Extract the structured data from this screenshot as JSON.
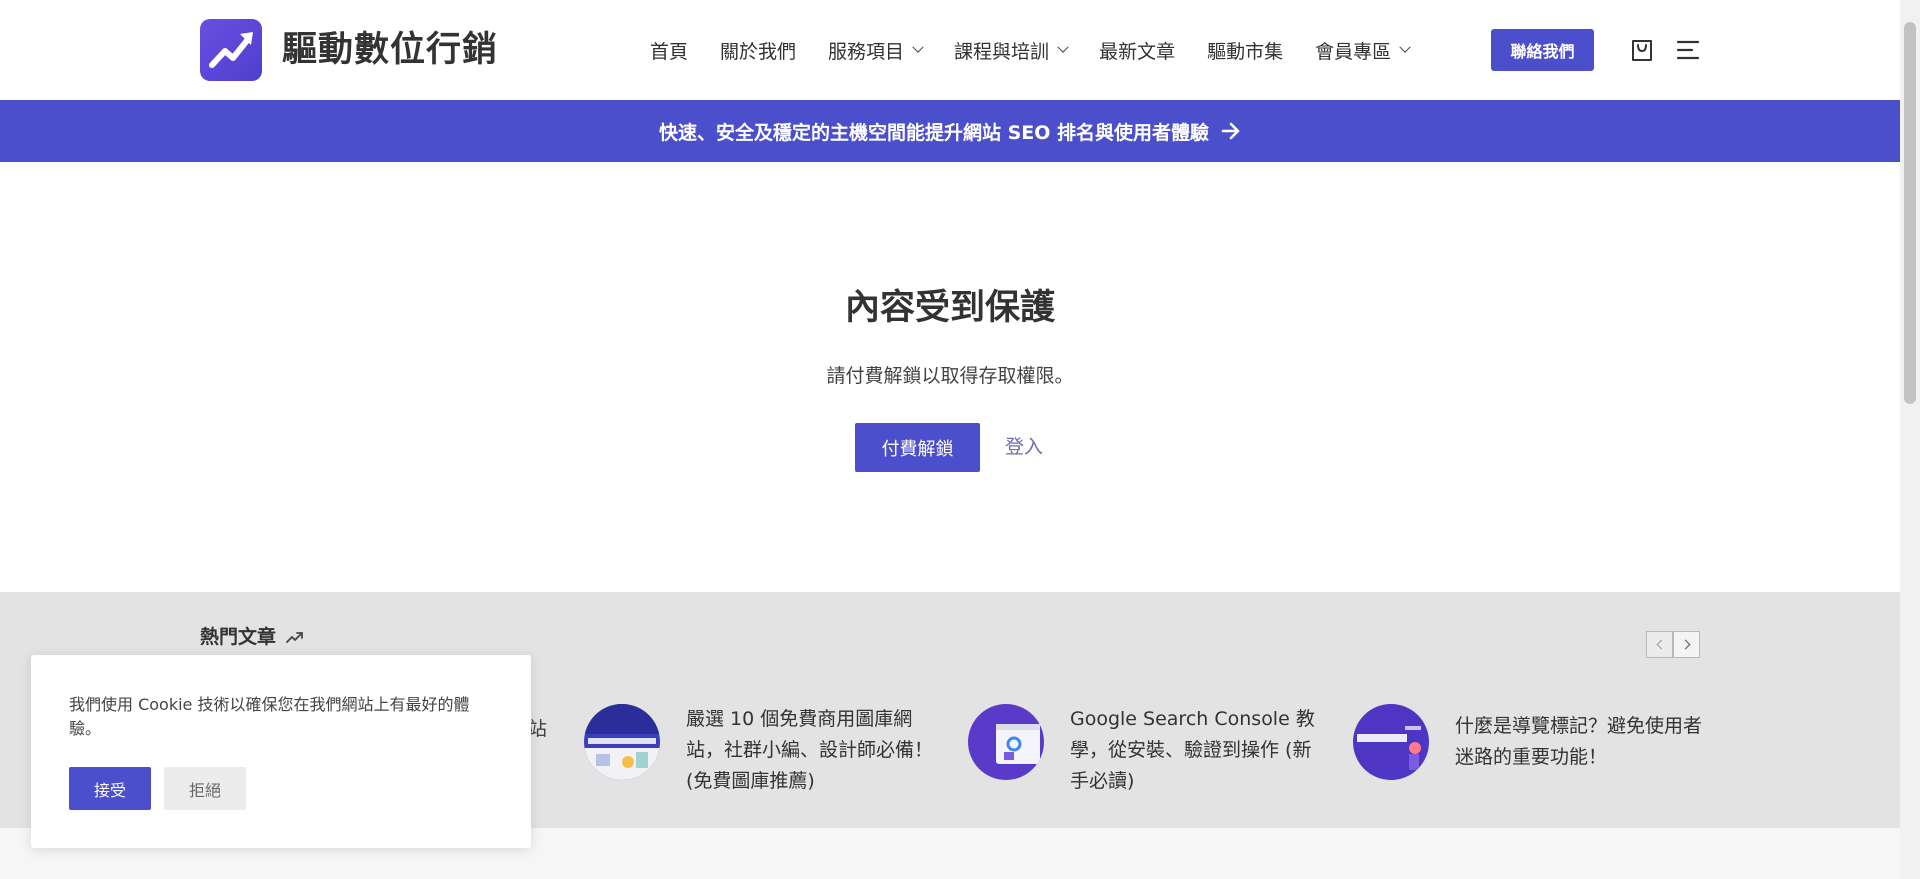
{
  "brand": {
    "name": "驅動數位行銷",
    "accent": "#4b4fcb"
  },
  "nav": {
    "items": [
      {
        "label": "首頁",
        "dropdown": false
      },
      {
        "label": "關於我們",
        "dropdown": false
      },
      {
        "label": "服務項目",
        "dropdown": true
      },
      {
        "label": "課程與培訓",
        "dropdown": true
      },
      {
        "label": "最新文章",
        "dropdown": false
      },
      {
        "label": "驅動市集",
        "dropdown": false
      },
      {
        "label": "會員專區",
        "dropdown": true
      }
    ],
    "contact_label": "聯絡我們",
    "cart_icon": "shopping-bag-icon",
    "menu_icon": "hamburger-menu-icon"
  },
  "promo": {
    "text": "快速、安全及穩定的主機空間能提升網站 SEO 排名與使用者體驗",
    "icon": "arrow-right-icon"
  },
  "protected": {
    "title": "內容受到保護",
    "description": "請付費解鎖以取得存取權限。",
    "pay_label": "付費解鎖",
    "login_label": "登入"
  },
  "popular": {
    "title": "熱門文章",
    "icon": "trending-up-icon",
    "partial_tail": "站",
    "posts": [
      {
        "lines": [
          "嚴選 10 個免費商用圖庫網",
          "站，社群小編、設計師必備！",
          "(免費圖庫推薦)"
        ]
      },
      {
        "lines": [
          "Google Search Console 教",
          "學，從安裝、驗證到操作 (新",
          "手必讀)"
        ]
      },
      {
        "lines": [
          "什麼是導覽標記？避免使用者",
          "迷路的重要功能！"
        ]
      }
    ]
  },
  "cookie": {
    "text": "我們使用 Cookie 技術以確保您在我們網站上有最好的體驗。",
    "accept_label": "接受",
    "reject_label": "拒絕"
  }
}
